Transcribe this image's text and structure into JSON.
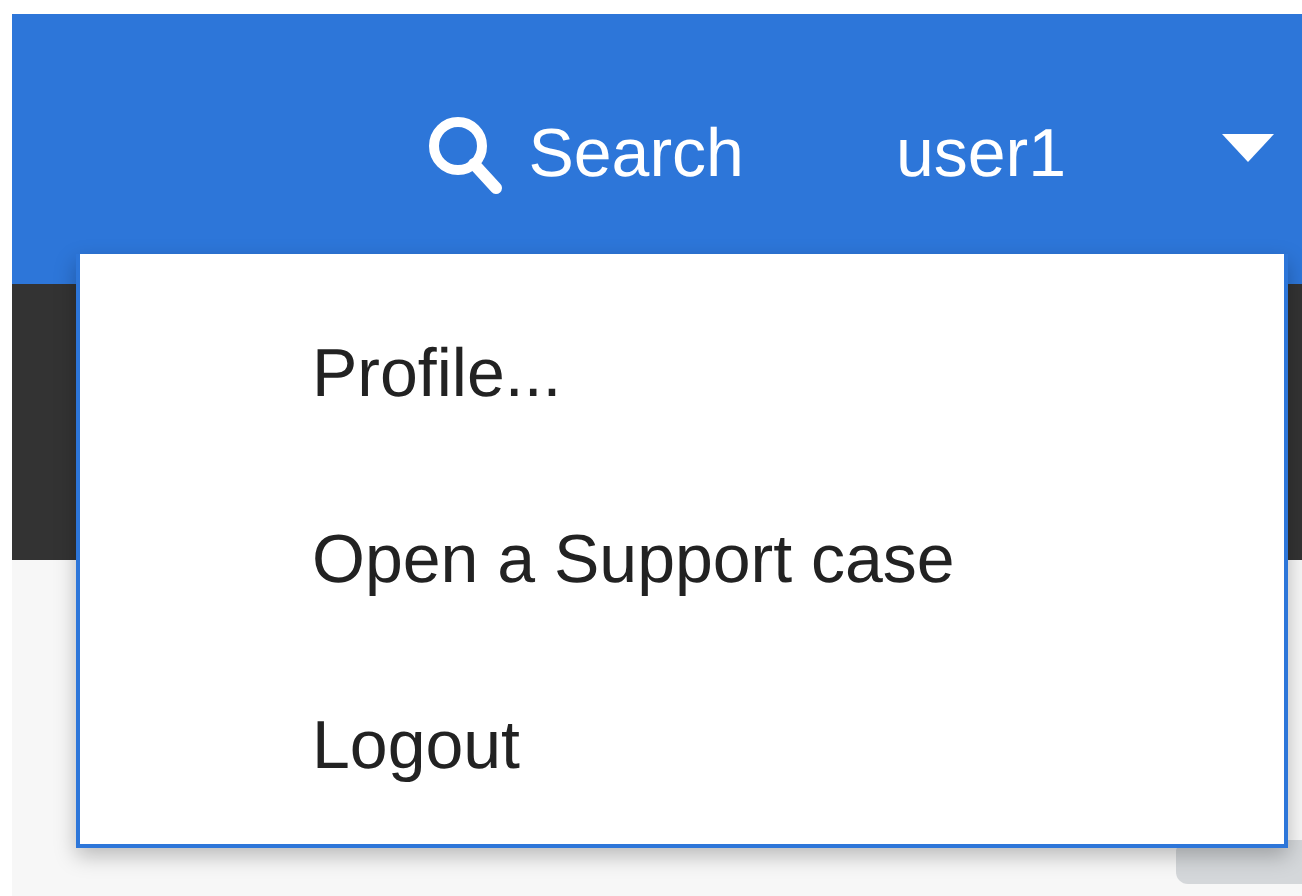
{
  "header": {
    "search": {
      "label": "Search"
    },
    "user": {
      "label": "user1",
      "expanded": true
    }
  },
  "user_menu": {
    "items": [
      {
        "label": "Profile..."
      },
      {
        "label": "Open a Support case"
      },
      {
        "label": "Logout"
      }
    ]
  }
}
